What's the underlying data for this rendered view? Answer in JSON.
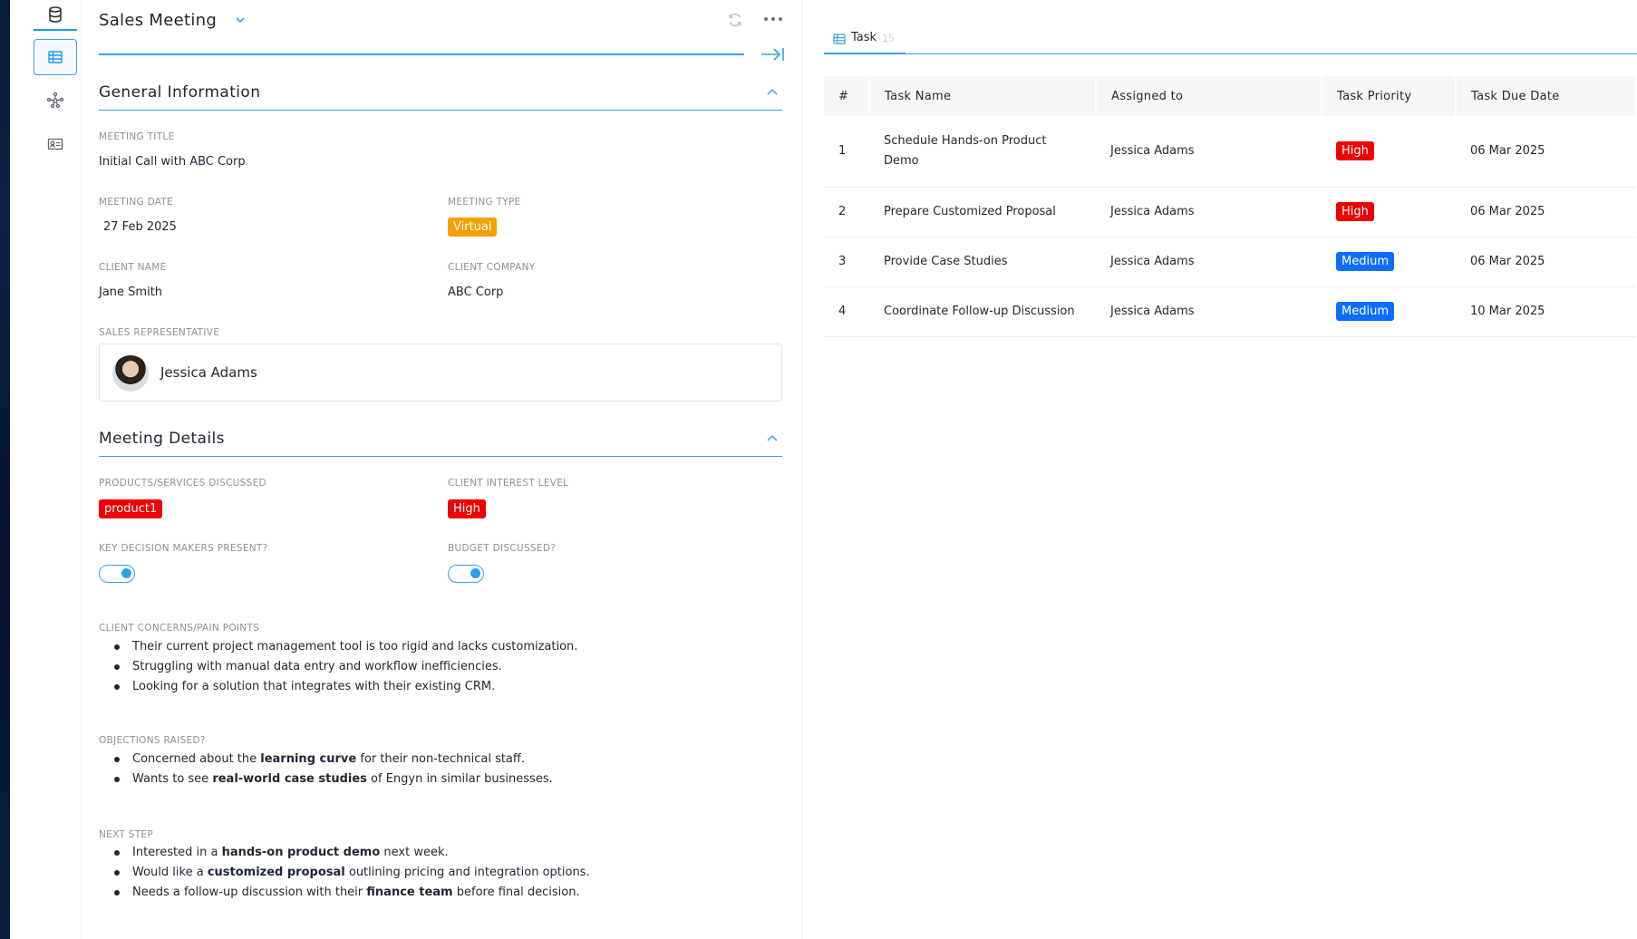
{
  "header": {
    "title": "Sales Meeting"
  },
  "sections": {
    "general": "General Information",
    "details": "Meeting Details"
  },
  "fields": {
    "meeting_title": {
      "label": "MEETING TITLE",
      "value": "Initial Call with ABC Corp"
    },
    "meeting_date": {
      "label": "MEETING DATE",
      "value": "27 Feb 2025"
    },
    "meeting_type": {
      "label": "MEETING TYPE",
      "value": "Virtual",
      "color": "#f5a000"
    },
    "client_name": {
      "label": "CLIENT NAME",
      "value": "Jane Smith"
    },
    "client_company": {
      "label": "CLIENT COMPANY",
      "value": "ABC Corp"
    },
    "sales_rep": {
      "label": "SALES REPRESENTATIVE",
      "value": "Jessica Adams"
    },
    "products": {
      "label": "PRODUCTS/SERVICES DISCUSSED",
      "value": "product1",
      "color": "#ee0000"
    },
    "interest": {
      "label": "CLIENT INTEREST LEVEL",
      "value": "High",
      "color": "#ee0000"
    },
    "decision_makers": {
      "label": "KEY DECISION MAKERS PRESENT?",
      "checked": true
    },
    "budget": {
      "label": "BUDGET DISCUSSED?",
      "checked": true
    }
  },
  "concerns": {
    "label": "CLIENT CONCERNS/PAIN POINTS",
    "items": [
      "Their current project management tool is too rigid and lacks customization.",
      "Struggling with manual data entry and workflow inefficiencies.",
      "Looking for a solution that integrates with their existing CRM."
    ]
  },
  "objections": {
    "label": "OBJECTIONS RAISED?",
    "items": [
      {
        "pre": "Concerned about the ",
        "bold": "learning curve",
        "post": " for their non-technical staff."
      },
      {
        "pre": "Wants to see ",
        "bold": "real-world case studies",
        "post": " of Engyn in similar businesses."
      }
    ]
  },
  "next_step": {
    "label": "NEXT STEP",
    "items": [
      {
        "pre": "Interested in a ",
        "bold": "hands-on product demo",
        "post": " next week."
      },
      {
        "pre": "Would like a ",
        "bold": "customized proposal",
        "post": " outlining pricing and integration options."
      },
      {
        "pre": "Needs a follow-up discussion with their ",
        "bold": "finance team",
        "post": " before final decision."
      }
    ]
  },
  "tab": {
    "label": "Task",
    "count": "15"
  },
  "table": {
    "columns": [
      "#",
      "Task Name",
      "Assigned to",
      "Task Priority",
      "Task Due Date"
    ],
    "rows": [
      {
        "num": "1",
        "name": "Schedule Hands-on Product Demo",
        "assigned": "Jessica Adams",
        "priority": "High",
        "priority_color": "#ee0000",
        "due": "06 Mar 2025"
      },
      {
        "num": "2",
        "name": "Prepare Customized Proposal",
        "assigned": "Jessica Adams",
        "priority": "High",
        "priority_color": "#ee0000",
        "due": "06 Mar 2025"
      },
      {
        "num": "3",
        "name": "Provide Case Studies",
        "assigned": "Jessica Adams",
        "priority": "Medium",
        "priority_color": "#0d6efd",
        "due": "06 Mar 2025"
      },
      {
        "num": "4",
        "name": "Coordinate Follow-up Discussion",
        "assigned": "Jessica Adams",
        "priority": "Medium",
        "priority_color": "#0d6efd",
        "due": "10 Mar 2025"
      }
    ]
  },
  "icons": {
    "rail": [
      "database-icon",
      "table-icon",
      "graph-icon",
      "contact-card-icon"
    ],
    "header": [
      "chevron-down-icon",
      "refresh-icon",
      "more-icon",
      "collapse-panel-icon"
    ],
    "section": [
      "chevron-up-icon"
    ]
  }
}
